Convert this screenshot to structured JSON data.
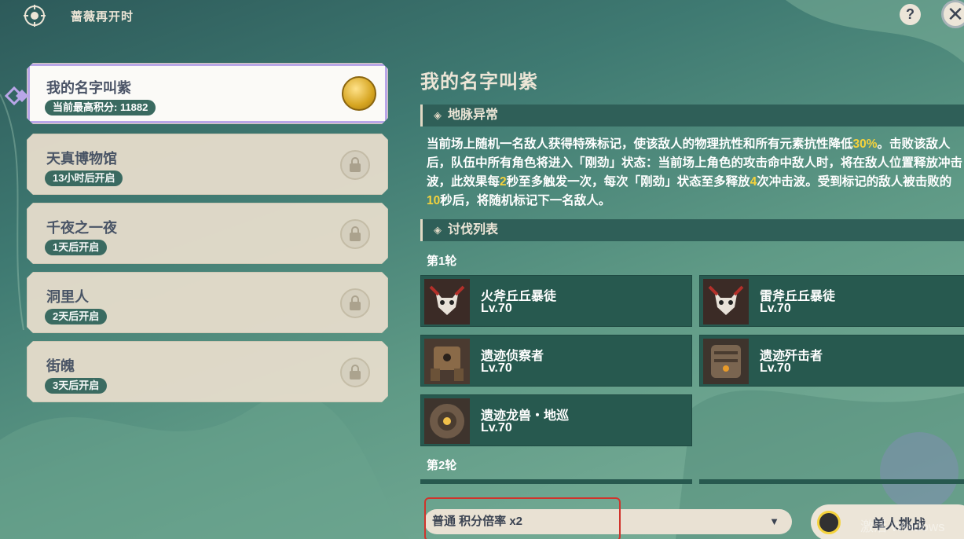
{
  "header": {
    "event_name": "蔷薇再开时",
    "help_label": "?",
    "close_label": "✕"
  },
  "stages": [
    {
      "title": "我的名字叫紫",
      "badge": "当前最高积分: 11882",
      "state": "selected",
      "icon": "medal-icon"
    },
    {
      "title": "天真博物馆",
      "badge": "13小时后开启",
      "state": "locked",
      "icon": "lock-icon"
    },
    {
      "title": "千夜之一夜",
      "badge": "1天后开启",
      "state": "locked",
      "icon": "lock-icon"
    },
    {
      "title": "洞里人",
      "badge": "2天后开启",
      "state": "locked",
      "icon": "lock-icon"
    },
    {
      "title": "街魄",
      "badge": "3天后开启",
      "state": "locked",
      "icon": "lock-icon"
    }
  ],
  "detail": {
    "title": "我的名字叫紫",
    "ley_line": {
      "header": "地脉异常",
      "text_parts": [
        "当前场上随机一名敌人获得特殊标记，使该敌人的物理抗性和所有元素抗性降低",
        "30%",
        "。击败该敌人后，队伍中所有角色将进入「刚劲」状态：当前场上角色的攻击命中敌人时，将在敌人位置释放冲击波，此效果每",
        "2",
        "秒至多触发一次，每次「刚劲」状态至多释放",
        "4",
        "次冲击波。受到标记的敌人被击败的",
        "10",
        "秒后，将随机标记下一名敌人。"
      ]
    },
    "enemy_list": {
      "header": "讨伐列表",
      "round1_label": "第1轮",
      "round2_label": "第2轮",
      "enemies": [
        {
          "name": "火斧丘丘暴徒",
          "level": "Lv.70"
        },
        {
          "name": "雷斧丘丘暴徒",
          "level": "Lv.70"
        },
        {
          "name": "遗迹侦察者",
          "level": "Lv.70"
        },
        {
          "name": "遗迹歼击者",
          "level": "Lv.70"
        },
        {
          "name": "遗迹龙兽・地巡",
          "level": "Lv.70"
        }
      ]
    }
  },
  "footer": {
    "mode_select_value": "普通 积分倍率 x2",
    "start_button_label": "单人挑战",
    "watermark": "激活 Windows"
  },
  "colors": {
    "accent_gold": "#f4d23c",
    "card_teal": "#27594f",
    "highlight_red": "#d0342c"
  }
}
